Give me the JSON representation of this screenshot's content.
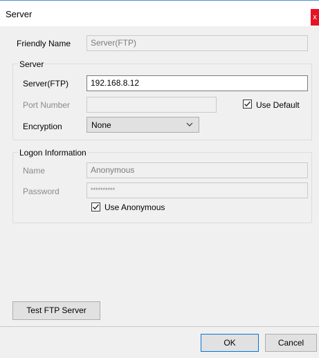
{
  "window": {
    "title": "Server",
    "close_glyph": "x"
  },
  "friendly_name": {
    "label": "Friendly Name",
    "value": "Server(FTP)"
  },
  "server_group": {
    "title": "Server",
    "server_label": "Server(FTP)",
    "server_value": "192.168.8.12",
    "port_label": "Port Number",
    "port_value": "",
    "use_default_label": "Use Default",
    "use_default_checked": true,
    "encryption_label": "Encryption",
    "encryption_value": "None"
  },
  "logon_group": {
    "title": "Logon Information",
    "name_label": "Name",
    "name_value": "Anonymous",
    "password_label": "Password",
    "password_value": "**********",
    "use_anonymous_label": "Use Anonymous",
    "use_anonymous_checked": true
  },
  "buttons": {
    "test_label": "Test FTP Server",
    "ok_label": "OK",
    "cancel_label": "Cancel"
  },
  "icons": [
    "close-icon",
    "checkmark-icon",
    "chevron-down-icon"
  ]
}
